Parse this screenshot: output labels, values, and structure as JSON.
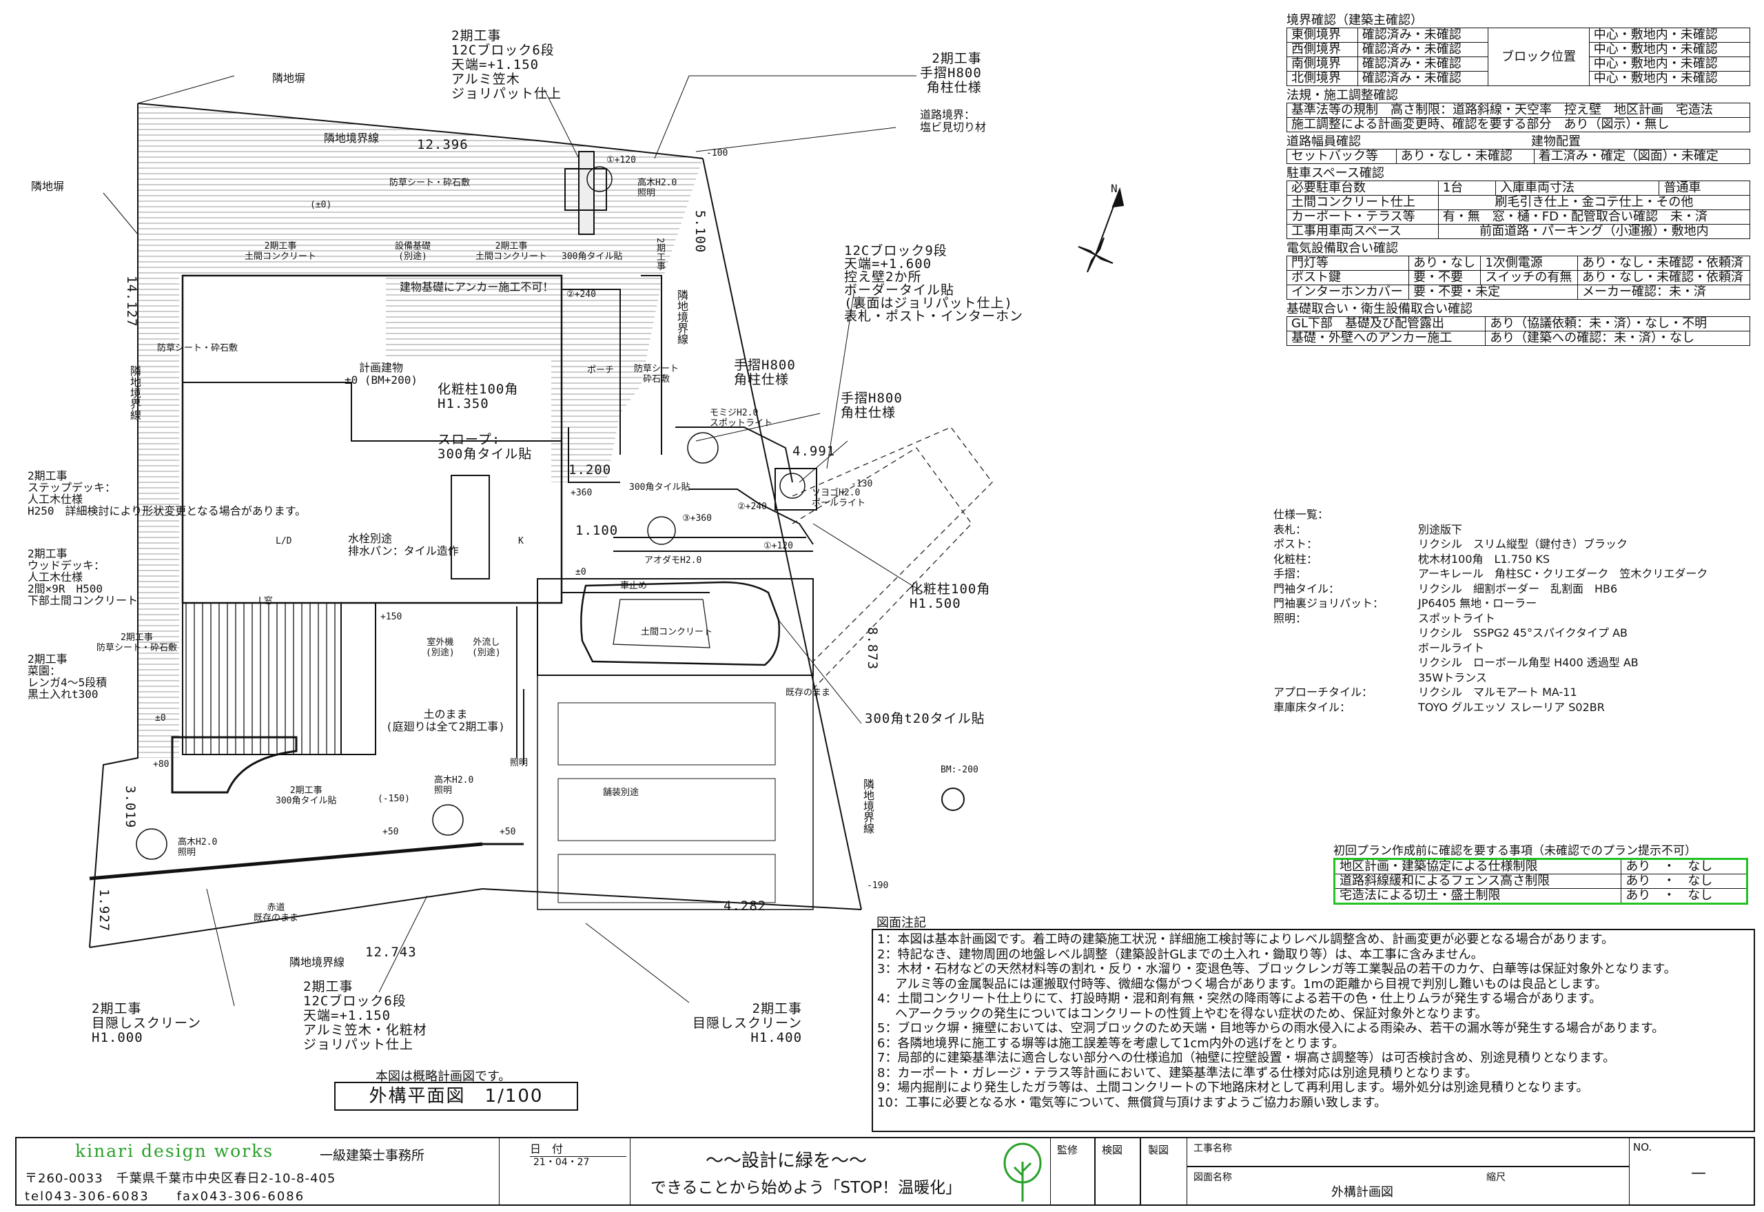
{
  "plan": {
    "labels": {
      "neighbor_wall_top": "隣地塀",
      "neighbor_wall_left": "隣地塀",
      "boundary_top": "隣地境界線",
      "dim_top": "12.396",
      "weed_top": "防草シート・砕石敷",
      "pm0_a": "(±0)",
      "phase2_concrete_a": "2期工事\n土間コンクリート",
      "equipment_base": "設備基礎\n(別途)",
      "phase2_concrete_b": "2期工事\n土間コンクリート",
      "tile300_a": "300角タイル貼",
      "anchor_warning": "建物基礎にアンカー施工不可！",
      "weed_left": "防草シート・砕石敷",
      "planned_building": "計画建物\n±0 (BM+200)",
      "porch": "ポーチ",
      "dim_left": "14.127",
      "boundary_left": "隣地境界線",
      "post_100": "化粧柱100角\nH1.350",
      "slope": "スロープ:\n300角タイル貼",
      "dim_1200": "1.200",
      "plus360_a": "+360",
      "dim_1100": "1.100",
      "tile300_b": "300角タイル貼",
      "step_deck": "2期工事\nステップデッキ：\n人工木仕様\nH250　詳細検討により形状変更となる場合があります。",
      "faucet": "水栓別途\n排水パン：タイル造作",
      "ld": "L/D",
      "kitchen": "K",
      "wood_deck": "2期工事\nウッドデッキ：\n人工木仕様\n2間×9R　H500\n下部土間コンクリート",
      "l_window": "L窓",
      "phase2_weed": "2期工事\n防草シート・砕石敷",
      "plus150": "+150",
      "outdoor_unit": "室外機\n(別途)",
      "sink": "外流し\n(別途)",
      "garden": "2期工事\n菜園：\nレンガ4～5段積\n黒土入れt300",
      "pm0_b": "±0",
      "soil": "土のまま\n(庭廻りは全て2期工事)",
      "plus80": "+80",
      "lighting": "照明",
      "phase2_tile": "2期工事\n300角タイル貼",
      "minus150": "(-150)",
      "plus50_a": "+50",
      "plus50_b": "+50",
      "tall_tree_a": "高木H2.0\n照明",
      "tall_tree_b": "高木H2.0\n照明",
      "red_road": "赤道\n既存のまま",
      "dim_3019": "3.019",
      "dim_1927": "1.927",
      "boundary_bottom": "隣地境界線",
      "dim_bottom": "12.743",
      "screen_left": "2期工事\n目隠しスクリーン\nH1.000",
      "block_bottom": "2期工事\n12Cブロック6段\n天端=+1.150\nアルミ笠木・化粧材\nジョリパット仕上",
      "screen_right": "2期工事\n目隠しスクリーン\nH1.400",
      "block_top": "2期工事\n12Cブロック6段\n天端=+1.150\nアルミ笠木\nジョリパット仕上",
      "handrail_top": "2期工事\n手摺H800\n角柱仕様",
      "road_boundary": "道路境界：\n塩ビ見切り材",
      "minus100": "-100",
      "plus120_a": "①+120",
      "tall_tree_c": "高木H2.0\n照明",
      "dim_5100": "5.100",
      "phase2_small": "2期工事",
      "plus240_a": "②+240",
      "boundary_mid": "隣地境界線",
      "block9": "12Cブロック9段\n天端=+1.600\n控え壁2か所\nボーダータイル貼\n(裏面はジョリパット仕上)\n表札・ポスト・インターホン",
      "weed_mid": "防草シート\n砕石敷",
      "handrail_a": "手摺H800\n角柱仕様",
      "maple": "モミジH2.0\nスポットライト",
      "handrail_b": "手摺H800\n角柱仕様",
      "dim_4991": "4.991",
      "minus130": "-130",
      "syouyou": "ソヨゴH2.0\nポールライト",
      "plus240_b": "②+240",
      "plus360_b": "③+360",
      "plus120_b": "①+120",
      "aodamo": "アオダモH2.0",
      "pm0_c": "±0",
      "car_stop": "車止め",
      "post_100b": "化粧柱100角\nH1.500",
      "earth_concrete": "土間コンクリート",
      "existing": "既存のまま",
      "dim_8873": "8.873",
      "tile300t20": "300角t20タイル貼",
      "paving": "舗装別途",
      "bm": "BM:-200",
      "boundary_right": "隣地境界線",
      "minus190": "-190",
      "dim_4282": "4.282",
      "north": "N"
    }
  },
  "checklist": {
    "boundary_title": "境界確認（建築主確認）",
    "boundary_rows": [
      {
        "side": "東側境界",
        "status": "確認済み・未確認",
        "loc": "中心・敷地内・未確認"
      },
      {
        "side": "西側境界",
        "status": "確認済み・未確認",
        "loc": "中心・敷地内・未確認"
      },
      {
        "side": "南側境界",
        "status": "確認済み・未確認",
        "loc": "中心・敷地内・未確認"
      },
      {
        "side": "北側境界",
        "status": "確認済み・未確認",
        "loc": "中心・敷地内・未確認"
      }
    ],
    "block_position": "ブロック位置",
    "law_title": "法規・施工調整確認",
    "law_rows": [
      "基準法等の規制　高さ制限：道路斜線・天空率　控え壁　地区計画　宅造法",
      "施工調整による計画変更時、確認を要する部分　あり（図示）・無し"
    ],
    "road_title": "道路幅員確認",
    "building_title": "建物配置",
    "setback": "セットバック等",
    "setback_val": "あり・なし・未確認",
    "building_val": "着工済み・確定（図面）・未確定",
    "parking_title": "駐車スペース確認",
    "parking_rows": [
      [
        "必要駐車台数",
        "1台",
        "入庫車両寸法",
        "普通車"
      ],
      [
        "土間コンクリート仕上",
        "刷毛引き仕上・金コテ仕上・その他"
      ],
      [
        "カーポート・テラス等",
        "有・無　窓・樋・FD・配管取合い確認　未・済"
      ],
      [
        "工事用車両スペース",
        "前面道路・パーキング（小運搬）・敷地内"
      ]
    ],
    "elec_title": "電気設備取合い確認",
    "elec_rows": [
      [
        "門灯等",
        "あり・なし",
        "1次側電源",
        "あり・なし・未確認・依頼済"
      ],
      [
        "ポスト鍵",
        "要・不要",
        "スイッチの有無",
        "あり・なし・未確認・依頼済"
      ],
      [
        "インターホンカバー",
        "要・不要・未定",
        "メーカー確認：未・済"
      ]
    ],
    "found_title": "基礎取合い・衛生設備取合い確認",
    "found_rows": [
      [
        "GL下部　基礎及び配管露出",
        "あり（協議依頼：未・済）・なし・不明"
      ],
      [
        "基礎・外壁へのアンカー施工",
        "あり（建築への確認：未・済）・なし"
      ]
    ]
  },
  "spec": {
    "title": "仕様一覧：",
    "rows": [
      [
        "表札：",
        "別途版下"
      ],
      [
        "ポスト：",
        "リクシル　スリム縦型（鍵付き）ブラック"
      ],
      [
        "化粧柱：",
        "枕木材100角　L1.750 KS"
      ],
      [
        "手摺：",
        "アーキレール　角柱SC・クリエダーク　笠木クリエダーク"
      ],
      [
        "門袖タイル：",
        "リクシル　細割ボーダー　乱割面　HB6"
      ],
      [
        "門袖裏ジョリパット：",
        "JP6405 無地・ローラー"
      ],
      [
        "照明：",
        "スポットライト"
      ],
      [
        "",
        "リクシル　SSPG2 45°スパイクタイプ AB"
      ],
      [
        "",
        "ボールライト"
      ],
      [
        "",
        "リクシル　ローボール角型 H400 透過型 AB"
      ],
      [
        "",
        "35Wトランス"
      ],
      [
        "アプローチタイル：",
        "リクシル　マルモアート MA-11"
      ],
      [
        "車庫床タイル：",
        "TOYO グルエッソ スレーリア S02BR"
      ]
    ]
  },
  "prelim": {
    "title": "初回プラン作成前に確認を要する事項（未確認でのプラン提示不可）",
    "rows": [
      {
        "item": "地区計画・建築協定による仕様制限",
        "val": "あり　・　なし"
      },
      {
        "item": "道路斜線緩和によるフェンス高さ制限",
        "val": "あり　・　なし"
      },
      {
        "item": "宅造法による切土・盛土制限",
        "val": "あり　・　なし"
      }
    ],
    "accent": "#22c222"
  },
  "notes": {
    "title": "図面注記",
    "lines": [
      "1：本図は基本計画図です。着工時の建築施工状況・詳細施工検討等によりレベル調整含め、計画変更が必要となる場合があります。",
      "2：特記なき、建物周囲の地盤レベル調整（建築設計GLまでの土入れ・鋤取り等）は、本工事に含みません。",
      "3：木材・石材などの天然材料等の割れ・反り・水溜り・変退色等、ブロックレンガ等工業製品の若干のカケ、白華等は保証対象外となります。",
      "アルミ等の金属製品には運搬取付時等、微細な傷がつく場合があります。1mの距離から目視で判別し難いものは良品とします。",
      "4：土間コンクリート仕上りにて、打設時期・混和剤有無・突然の降雨等による若干の色・仕上りムラが発生する場合があります。",
      "ヘアークラックの発生についてはコンクリートの性質上やむを得ない症状のため、保証対象外となります。",
      "5：ブロック塀・擁壁においては、空洞ブロックのため天端・目地等からの雨水侵入による雨染み、若干の漏水等が発生する場合があります。",
      "6：各隣地境界に施工する塀等は施工誤差等を考慮して1cm内外の逃げをとります。",
      "7：局部的に建築基準法に適合しない部分への仕様追加（袖壁に控壁設置・塀高さ調整等）は可否検討含め、別途見積りとなります。",
      "8：カーポート・ガレージ・テラス等計画において、建築基準法に準ずる仕様対応は別途見積りとなります。",
      "9：場内掘削により発生したガラ等は、土間コンクリートの下地路床材として再利用します。場外処分は別途見積りとなります。",
      "10：工事に必要となる水・電気等について、無償貸与頂けますようご協力お願い致します。"
    ]
  },
  "caption": {
    "note": "本図は概略計画図です。",
    "title": "外構平面図　1/100"
  },
  "titleblock": {
    "company": "kinari design works",
    "office": "一級建築士事務所",
    "address": "〒260-0033　千葉県千葉市中央区春日2-10-8-405",
    "tel": "tel043-306-6083　　fax043-306-6086",
    "date_label": "日　付",
    "date": "21・04・27",
    "slogan1": "～～設計に緑を～～",
    "slogan2": "できることから始めよう「STOP！温暖化」",
    "check1": "監修",
    "check2": "検図",
    "check3": "製図",
    "project_label": "工事名称",
    "drawing_label": "図面名称",
    "drawing_name": "外構計画図",
    "scale_label": "縮尺",
    "no_label": "NO.",
    "no_value": "—"
  }
}
